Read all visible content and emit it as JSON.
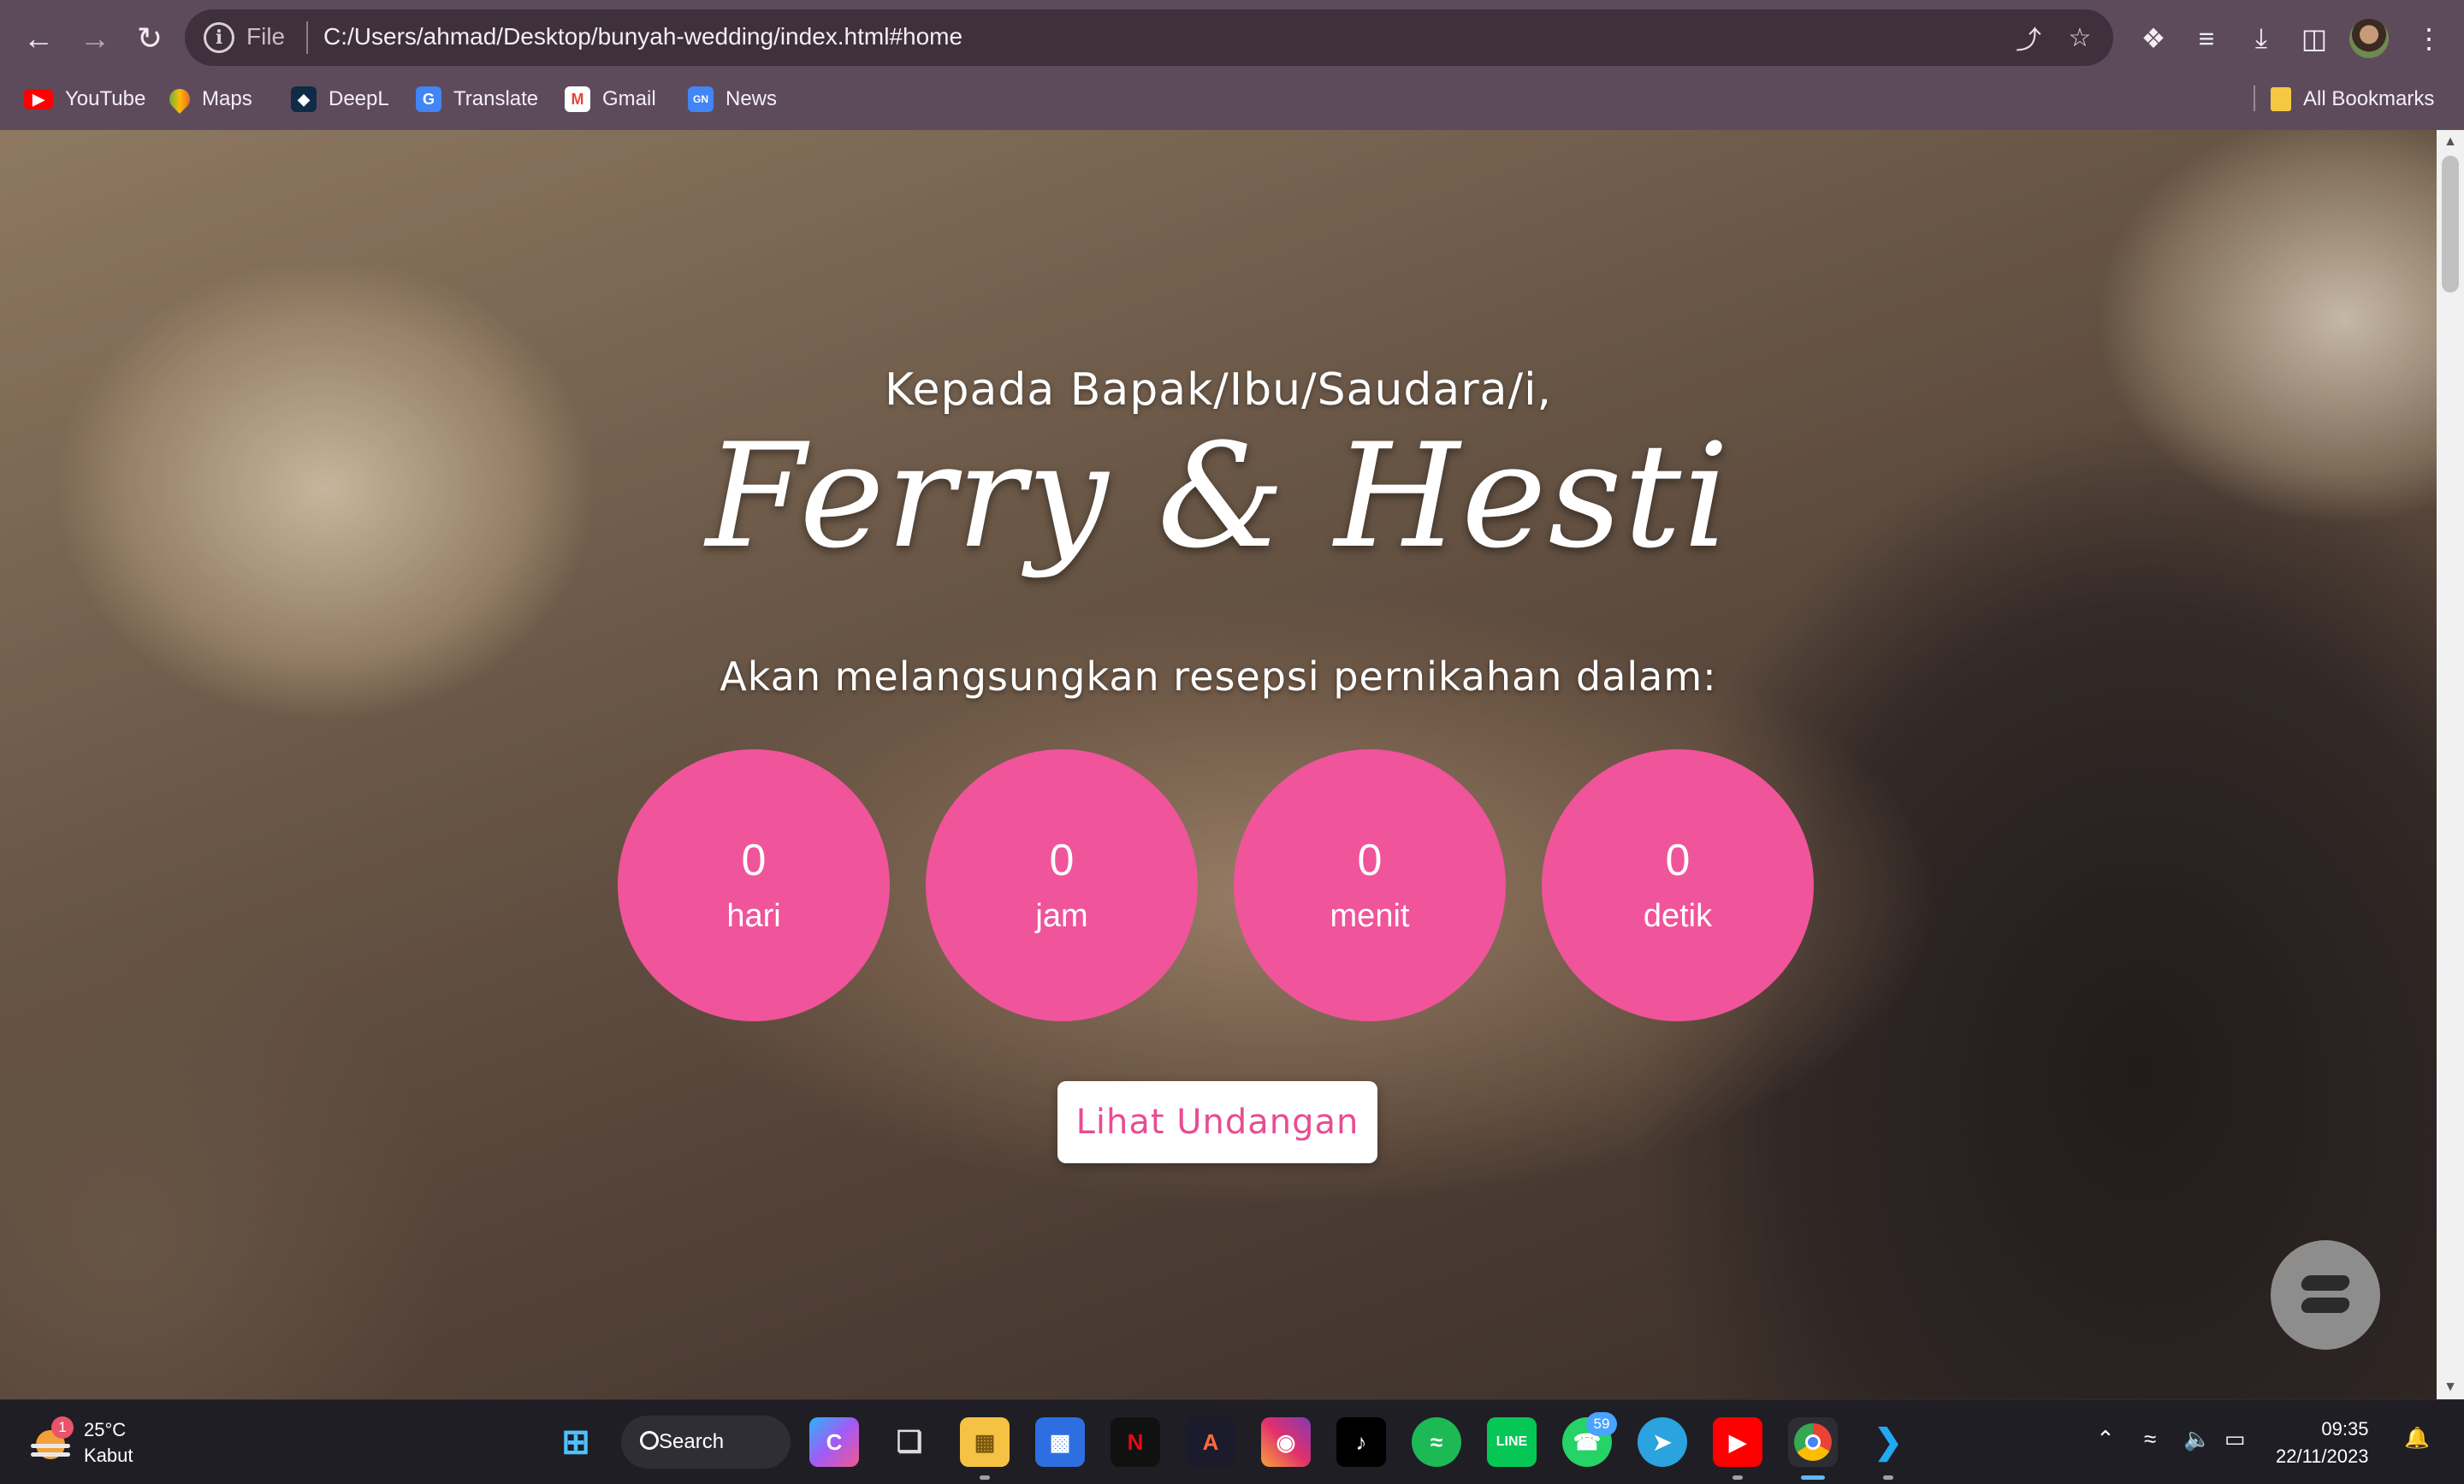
{
  "browser": {
    "file_label": "File",
    "url": "C:/Users/ahmad/Desktop/bunyah-wedding/index.html#home",
    "bookmarks": [
      {
        "label": "YouTube",
        "icon": "youtube-icon",
        "color": "#ff0000"
      },
      {
        "label": "Maps",
        "icon": "maps-icon",
        "color": "#34a853"
      },
      {
        "label": "DeepL",
        "icon": "deepl-icon",
        "color": "#0f2b46"
      },
      {
        "label": "Translate",
        "icon": "translate-icon",
        "color": "#4285f4"
      },
      {
        "label": "Gmail",
        "icon": "gmail-icon",
        "color": "#ea4335"
      },
      {
        "label": "News",
        "icon": "news-icon",
        "color": "#4285f4"
      }
    ],
    "all_bookmarks_label": "All Bookmarks"
  },
  "page": {
    "greeting": "Kepada Bapak/Ibu/Saudara/i,",
    "couple": "Ferry & Hesti",
    "subtitle": "Akan melangsungkan resepsi pernikahan dalam:",
    "countdown": [
      {
        "value": "0",
        "unit": "hari"
      },
      {
        "value": "0",
        "unit": "jam"
      },
      {
        "value": "0",
        "unit": "menit"
      },
      {
        "value": "0",
        "unit": "detik"
      }
    ],
    "cta_label": "Lihat Undangan",
    "accent_color": "#f0549a"
  },
  "taskbar": {
    "weather_temp": "25°C",
    "weather_desc": "Kabut",
    "weather_badge": "1",
    "search_label": "Search",
    "whatsapp_badge": "59",
    "time": "09:35",
    "date": "22/11/2023"
  }
}
